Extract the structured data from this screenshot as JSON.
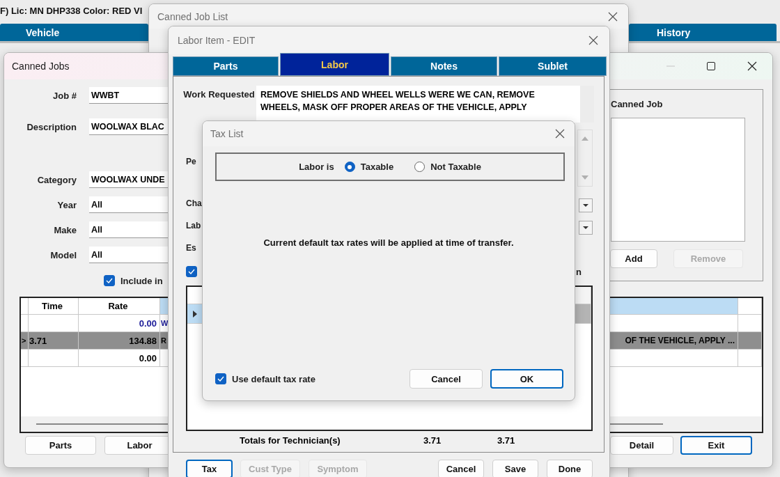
{
  "main_window": {
    "header": "F) Lic: MN DHP338 Color: RED VI",
    "tabs": [
      {
        "label": "Vehicle",
        "selected": false
      },
      {
        "label": "History",
        "selected": false
      }
    ]
  },
  "canned_jobs": {
    "title": "Canned Jobs",
    "job_fields": [
      {
        "label": "Job #",
        "value": "WWBT"
      },
      {
        "label": "Description",
        "value": "WOOLWAX BLAC"
      }
    ],
    "filter_fields": [
      {
        "label": "Category",
        "value": "WOOLWAX UNDE"
      },
      {
        "label": "Year",
        "value": "All"
      },
      {
        "label": "Make",
        "value": "All"
      },
      {
        "label": "Model",
        "value": "All"
      }
    ],
    "include_option": {
      "label": "Include in",
      "checked": true
    },
    "canned_job_group": {
      "label": "Canned Job",
      "buttons": [
        {
          "label": "Add",
          "disabled": false
        },
        {
          "label": "Remove",
          "disabled": true
        }
      ]
    },
    "grid": {
      "columns": [
        "Time",
        "Rate"
      ],
      "rows": [
        {
          "rate": "0.00",
          "column_3": "W",
          "selected": false,
          "color": "#1c1c99"
        },
        {
          "marker": ">",
          "time": "3.71",
          "rate": "134.88",
          "column_3": "R",
          "column_3_end": "OF THE VEHICLE, APPLY ...",
          "selected": true,
          "color": "#000000"
        },
        {
          "rate": "0.00",
          "selected": false,
          "color": "#000000"
        }
      ]
    },
    "left_buttons": [
      {
        "label": "Parts",
        "default": false
      },
      {
        "label": "Labor",
        "default": false
      }
    ],
    "right_buttons": [
      {
        "label": "Detail",
        "default": false
      },
      {
        "label": "Exit",
        "default": true
      }
    ]
  },
  "canned_job_list": {
    "title": "Canned Job List"
  },
  "labor_item": {
    "title": "Labor Item - EDIT",
    "tabs": [
      {
        "label": "Parts",
        "selected": false
      },
      {
        "label": "Labor",
        "selected": true
      },
      {
        "label": "Notes",
        "selected": false
      },
      {
        "label": "Sublet",
        "selected": false
      }
    ],
    "work_requested": {
      "label": "Work Requested",
      "lines": [
        "REMOVE SHIELDS AND WHEEL WELLS WERE WE CAN, REMOVE",
        "WHEELS, MASK OFF PROPER AREAS OF THE VEHICLE, APPLY"
      ]
    },
    "partial_labels": [
      "Pe",
      "Cha",
      "Lab",
      "Es"
    ],
    "option": {
      "label": "n",
      "checked": true
    },
    "totals": {
      "label": "Totals for Technician(s)",
      "values": [
        "3.71",
        "3.71"
      ]
    },
    "left_buttons": [
      {
        "label": "Tax",
        "default": true,
        "disabled": false
      },
      {
        "label": "Cust Type",
        "default": false,
        "disabled": true
      },
      {
        "label": "Symptom",
        "default": false,
        "disabled": true
      }
    ],
    "right_buttons": [
      {
        "label": "Cancel",
        "default": false,
        "disabled": false
      },
      {
        "label": "Save",
        "default": false,
        "disabled": false
      },
      {
        "label": "Done",
        "default": false,
        "disabled": false
      }
    ]
  },
  "tax_list": {
    "title": "Tax List",
    "group_label": "Labor is",
    "options": [
      {
        "label": "Taxable",
        "selected": true
      },
      {
        "label": "Not Taxable",
        "selected": false
      }
    ],
    "message": "Current default tax rates will be applied at time of transfer.",
    "use_default": {
      "label": "Use default tax rate",
      "checked": true
    },
    "buttons": [
      {
        "label": "Cancel",
        "default": false
      },
      {
        "label": "OK",
        "default": true
      }
    ]
  }
}
